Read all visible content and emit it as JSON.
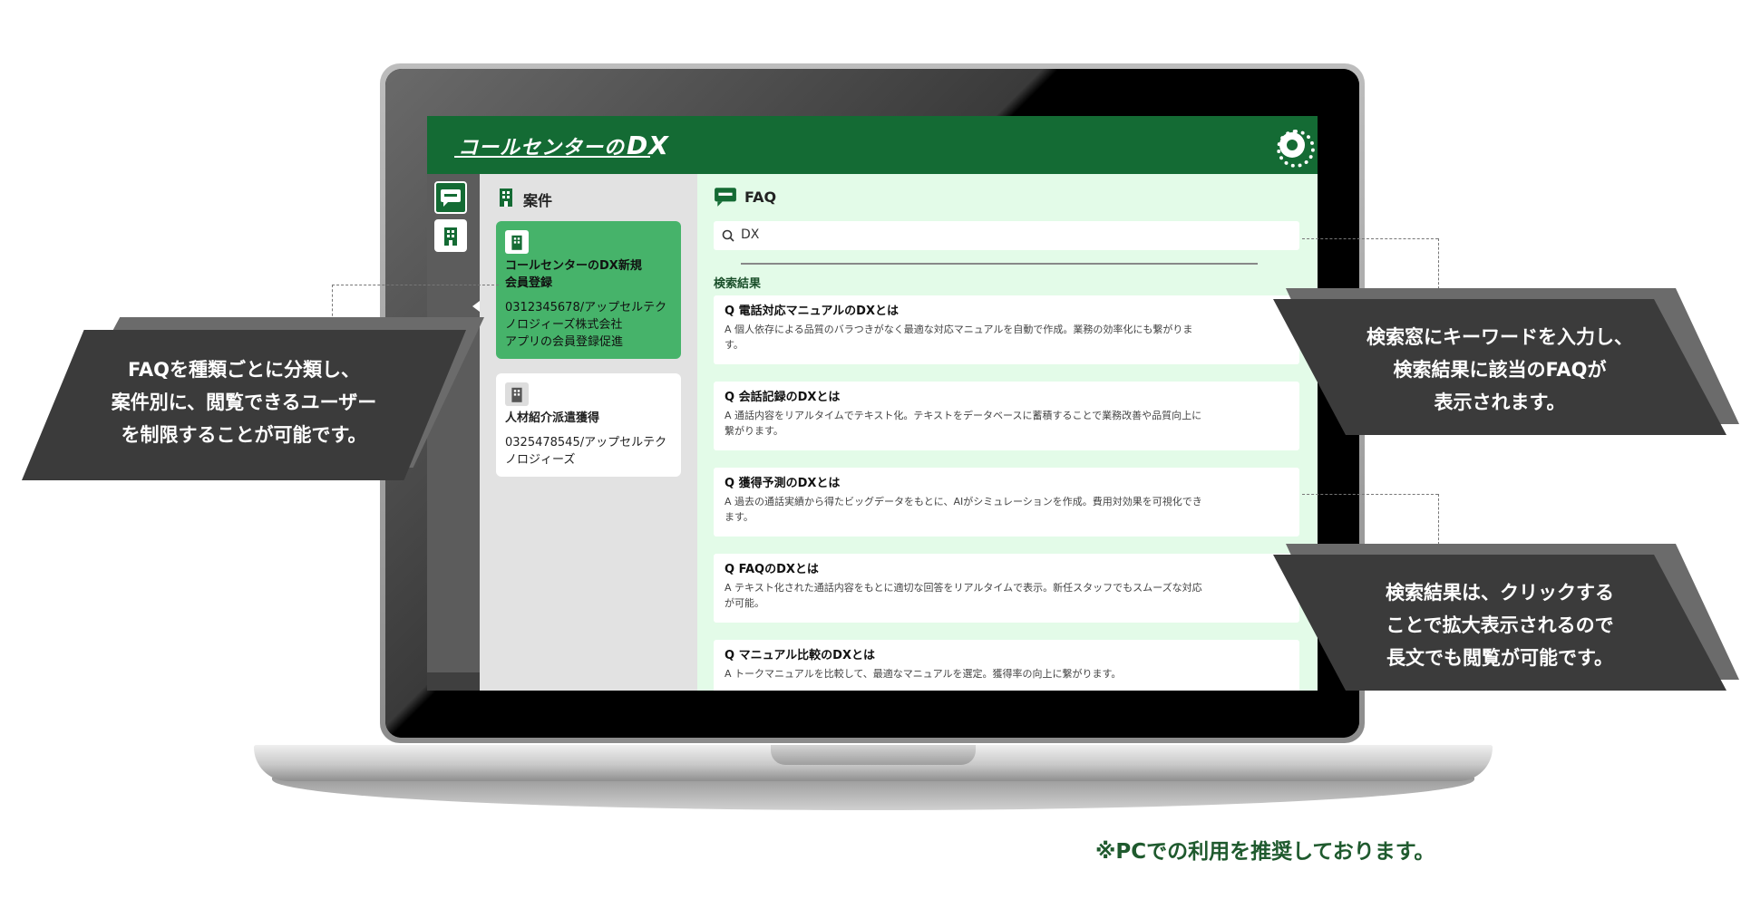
{
  "app": {
    "logo_text": "コールセンターの",
    "logo_dx": "DX"
  },
  "case_panel": {
    "title": "案件",
    "cases": [
      {
        "name": "コールセンターのDX新規\n会員登録",
        "detail": "0312345678/アップセルテク\nノロジィーズ株式会社\nアプリの会員登録促進"
      },
      {
        "name": "人材紹介派遣獲得",
        "detail": "0325478545/アップセルテク\nノロジィーズ"
      }
    ]
  },
  "faq_panel": {
    "title": "FAQ",
    "search_value": "DX",
    "results_label": "検索結果",
    "results": [
      {
        "q": "Q 電話対応マニュアルのDXとは",
        "a": "A 個人依存による品質のバラつきがなく最適な対応マニュアルを自動で作成。業務の効率化にも繋がりま す。"
      },
      {
        "q": "Q 会話記録のDXとは",
        "a": "A 通話内容をリアルタイムでテキスト化。テキストをデータベースに蓄積することで業務改善や品質向上に 繋がります。"
      },
      {
        "q": "Q 獲得予測のDXとは",
        "a": "A 過去の通話実績から得たビッグデータをもとに、AIがシミュレーションを作成。費用対効果を可視化でき ます。"
      },
      {
        "q": "Q FAQのDXとは",
        "a": "A テキスト化された通話内容をもとに適切な回答をリアルタイムで表示。新任スタッフでもスムーズな対応 が可能。"
      },
      {
        "q": "Q マニュアル比較のDXとは",
        "a": "A トークマニュアルを比較して、最適なマニュアルを選定。獲得率の向上に繋がります。"
      }
    ]
  },
  "callouts": {
    "left": "FAQを種類ごとに分類し、\n案件別に、閲覧できるユーザー\nを制限することが可能です。",
    "right_top": "検索窓にキーワードを入力し、\n検索結果に該当のFAQが\n表示されます。",
    "right_bottom": "検索結果は、クリックする\nことで拡大表示されるので\n長文でも閲覧が可能です。"
  },
  "footnote": "※PCでの利用を推奨しております。",
  "colors": {
    "header_green": "#146b34",
    "active_card_green": "#46b36a",
    "faq_bg": "#e3fbe8",
    "callout_dark": "#3b3b3b"
  }
}
